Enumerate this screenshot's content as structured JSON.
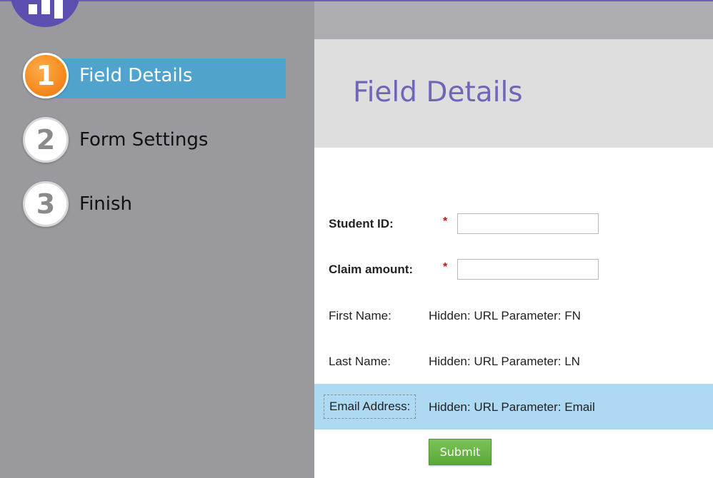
{
  "sidebar": {
    "steps": [
      {
        "number": "1",
        "label": "Field Details"
      },
      {
        "number": "2",
        "label": "Form Settings"
      },
      {
        "number": "3",
        "label": "Finish"
      }
    ]
  },
  "header": {
    "title": "Field Details"
  },
  "form": {
    "fields": [
      {
        "label": "Student ID:",
        "required": "*",
        "value": ""
      },
      {
        "label": "Claim amount:",
        "required": "*",
        "value": ""
      },
      {
        "label": "First Name:",
        "value": "Hidden: URL Parameter: FN"
      },
      {
        "label": "Last Name:",
        "value": "Hidden: URL Parameter: LN"
      },
      {
        "label": "Email Address:",
        "value": "Hidden: URL Parameter: Email"
      }
    ],
    "submit_label": "Submit"
  },
  "colors": {
    "accent_purple": "#6e66b8",
    "active_step_band": "#4fa3cc",
    "active_step_badge": "#f58b1f",
    "highlight_row": "#aed9f2",
    "submit_green": "#5aa736",
    "required_red": "#c0161b"
  }
}
